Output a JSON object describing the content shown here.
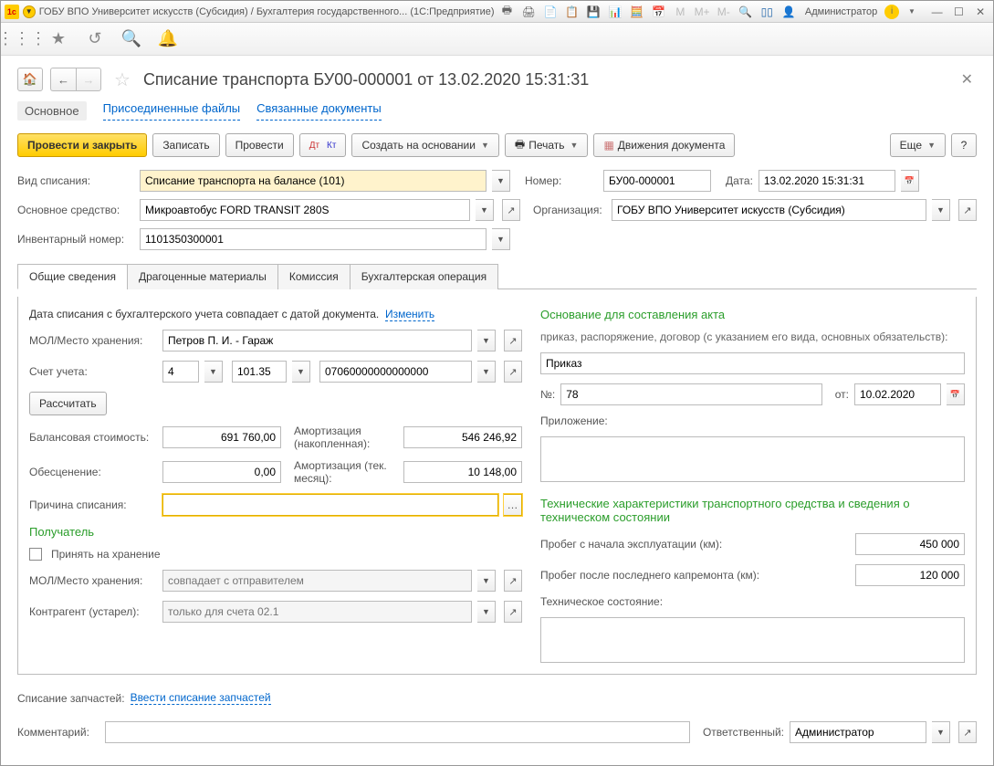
{
  "titlebar": {
    "title": "ГОБУ ВПО Университет искусств (Субсидия) / Бухгалтерия государственного... (1С:Предприятие)",
    "user": "Администратор"
  },
  "header": {
    "title": "Списание транспорта БУ00-000001 от 13.02.2020 15:31:31"
  },
  "nav": {
    "main": "Основное",
    "files": "Присоединенные файлы",
    "related": "Связанные документы"
  },
  "actions": {
    "post_close": "Провести и закрыть",
    "save": "Записать",
    "post": "Провести",
    "create_based": "Создать на основании",
    "print": "Печать",
    "movements": "Движения документа",
    "more": "Еще"
  },
  "form": {
    "type_lbl": "Вид списания:",
    "type_val": "Списание транспорта на балансе (101)",
    "num_lbl": "Номер:",
    "num_val": "БУ00-000001",
    "date_lbl": "Дата:",
    "date_val": "13.02.2020 15:31:31",
    "asset_lbl": "Основное средство:",
    "asset_val": "Микроавтобус FORD TRANSIT 280S",
    "org_lbl": "Организация:",
    "org_val": "ГОБУ ВПО Университет искусств (Субсидия)",
    "inv_lbl": "Инвентарный номер:",
    "inv_val": "1101350300001"
  },
  "tabs": {
    "t1": "Общие сведения",
    "t2": "Драгоценные материалы",
    "t3": "Комиссия",
    "t4": "Бухгалтерская операция"
  },
  "general": {
    "date_note": "Дата списания с бухгалтерского учета совпадает с датой документа.",
    "change": "Изменить",
    "mol_lbl": "МОЛ/Место хранения:",
    "mol_val": "Петров П. И. - Гараж",
    "acc_lbl": "Счет учета:",
    "acc1": "4",
    "acc2": "101.35",
    "acc3": "07060000000000000",
    "calc": "Рассчитать",
    "bal_lbl": "Балансовая стоимость:",
    "bal_val": "691 760,00",
    "dep_acc_lbl": "Амортизация (накопленная):",
    "dep_acc_val": "546 246,92",
    "imp_lbl": "Обесценение:",
    "imp_val": "0,00",
    "dep_cur_lbl": "Амортизация (тек. месяц):",
    "dep_cur_val": "10 148,00",
    "reason_lbl": "Причина списания:",
    "recipient_h": "Получатель",
    "keep_lbl": "Принять на хранение",
    "mol2_lbl": "МОЛ/Место хранения:",
    "mol2_ph": "совпадает с отправителем",
    "ctr_lbl": "Контрагент (устарел):",
    "ctr_ph": "только для счета 02.1"
  },
  "basis": {
    "h": "Основание для составления акта",
    "note": "приказ, распоряжение, договор (с указанием его вида, основных обязательств):",
    "doc": "Приказ",
    "num_lbl": "№:",
    "num_val": "78",
    "from_lbl": "от:",
    "from_val": "10.02.2020",
    "att_lbl": "Приложение:"
  },
  "tech": {
    "h": "Технические характеристики транспортного средства и сведения о техническом состоянии",
    "mil1_lbl": "Пробег с начала эксплуатации (км):",
    "mil1_val": "450 000",
    "mil2_lbl": "Пробег после последнего капремонта (км):",
    "mil2_val": "120 000",
    "cond_lbl": "Техническое состояние:"
  },
  "footer": {
    "parts_lbl": "Списание запчастей:",
    "parts_link": "Ввести списание запчастей",
    "comment_lbl": "Комментарий:",
    "resp_lbl": "Ответственный:",
    "resp_val": "Администратор"
  }
}
